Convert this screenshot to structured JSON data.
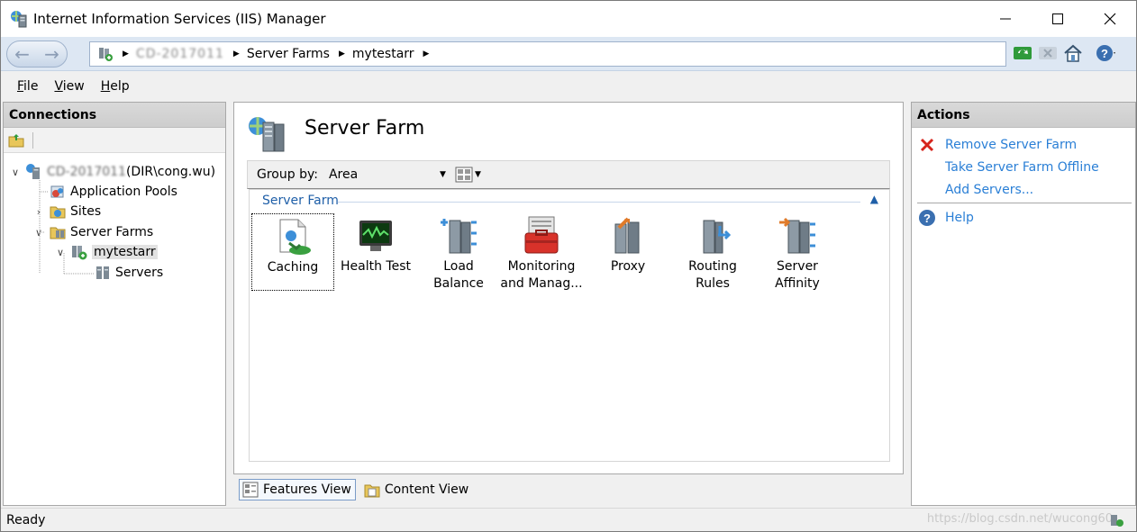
{
  "window": {
    "title": "Internet Information Services (IIS) Manager",
    "controls": {
      "minimize": "minimize",
      "maximize": "maximize",
      "close": "close"
    }
  },
  "addressbar": {
    "crumbs": [
      "CD-2017011",
      "Server Farms",
      "mytestarr"
    ]
  },
  "menu": {
    "items": [
      "File",
      "View",
      "Help"
    ],
    "accelerators": [
      "F",
      "V",
      "H"
    ]
  },
  "connections": {
    "title": "Connections",
    "tree": [
      {
        "label": "CD-2017011",
        "suffix": " (DIR\\cong.wu)",
        "icon": "server-icon"
      },
      {
        "label": "Application Pools",
        "icon": "app-pools-icon"
      },
      {
        "label": "Sites",
        "icon": "sites-icon"
      },
      {
        "label": "Server Farms",
        "icon": "server-farms-icon"
      },
      {
        "label": "mytestarr",
        "icon": "server-farm-icon"
      },
      {
        "label": "Servers",
        "icon": "servers-icon"
      }
    ]
  },
  "center": {
    "title": "Server Farm",
    "group_by_label": "Group by:",
    "group_by_value": "Area",
    "group_header": "Server Farm",
    "features": [
      {
        "label": "Caching",
        "icon": "caching-icon"
      },
      {
        "label": "Health Test",
        "icon": "health-test-icon"
      },
      {
        "label": "Load Balance",
        "icon": "load-balance-icon"
      },
      {
        "label": "Monitoring and Manag...",
        "icon": "monitoring-icon"
      },
      {
        "label": "Proxy",
        "icon": "proxy-icon"
      },
      {
        "label": "Routing Rules",
        "icon": "routing-rules-icon"
      },
      {
        "label": "Server Affinity",
        "icon": "server-affinity-icon"
      }
    ]
  },
  "viewtabs": {
    "features": "Features View",
    "content": "Content View"
  },
  "actions": {
    "title": "Actions",
    "items": [
      {
        "label": "Remove Server Farm",
        "icon": "remove-icon"
      },
      {
        "label": "Take Server Farm Offline",
        "icon": ""
      },
      {
        "label": "Add Servers...",
        "icon": ""
      },
      {
        "label": "Help",
        "icon": "help-icon"
      }
    ]
  },
  "status": {
    "text": "Ready",
    "watermark": "https://blog.csdn.net/wucong60"
  },
  "colors": {
    "link": "#2a7fd6",
    "group_header": "#1f5fa8",
    "panel_header": "#d3d3d3"
  }
}
